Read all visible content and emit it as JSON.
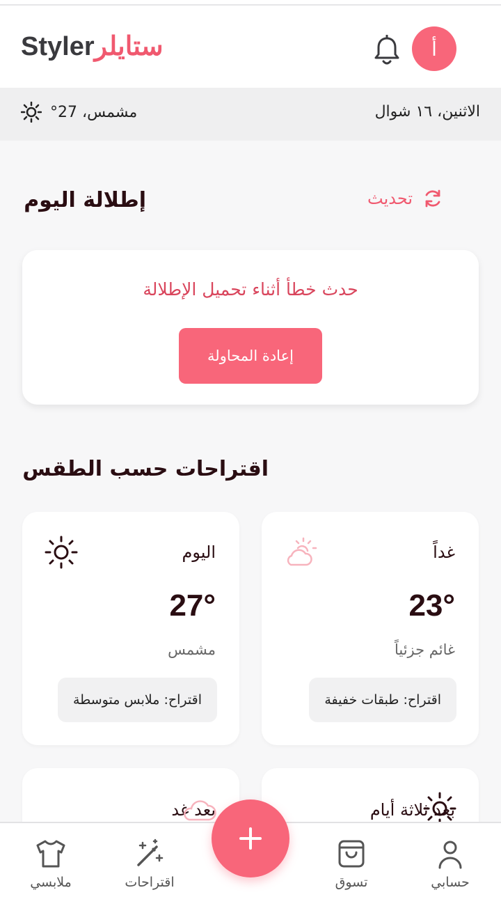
{
  "header": {
    "brand_ar": "ستايلر",
    "brand_en": "Styler",
    "avatar_letter": "أ",
    "accent": "#f8667a"
  },
  "infobar": {
    "date": "الاثنين، ١٦ شوال",
    "weather": "مشمس، 27°"
  },
  "outfit": {
    "title": "إطلالة اليوم",
    "refresh_label": "تحديث",
    "error_message": "حدث خطأ أثناء تحميل الإطلالة",
    "retry_label": "إعادة المحاولة"
  },
  "weather_section": {
    "title": "اقتراحات حسب الطقس",
    "cards": [
      {
        "day": "اليوم",
        "temp": "27°",
        "condition": "مشمس",
        "tip": "اقتراح: ملابس متوسطة",
        "icon": "sun-icon"
      },
      {
        "day": "غداً",
        "temp": "23°",
        "condition": "غائم جزئياً",
        "tip": "اقتراح: طبقات خفيفة",
        "icon": "partly-cloudy-icon"
      },
      {
        "day": "بعد غد",
        "icon": "cloud-icon"
      },
      {
        "day": "بعد ثلاثة أيام",
        "icon": "sun-icon"
      }
    ]
  },
  "nav": {
    "account": "حسابي",
    "shop": "تسوق",
    "suggestions": "اقتراحات",
    "clothes": "ملابسي",
    "add_icon": "plus-icon"
  }
}
